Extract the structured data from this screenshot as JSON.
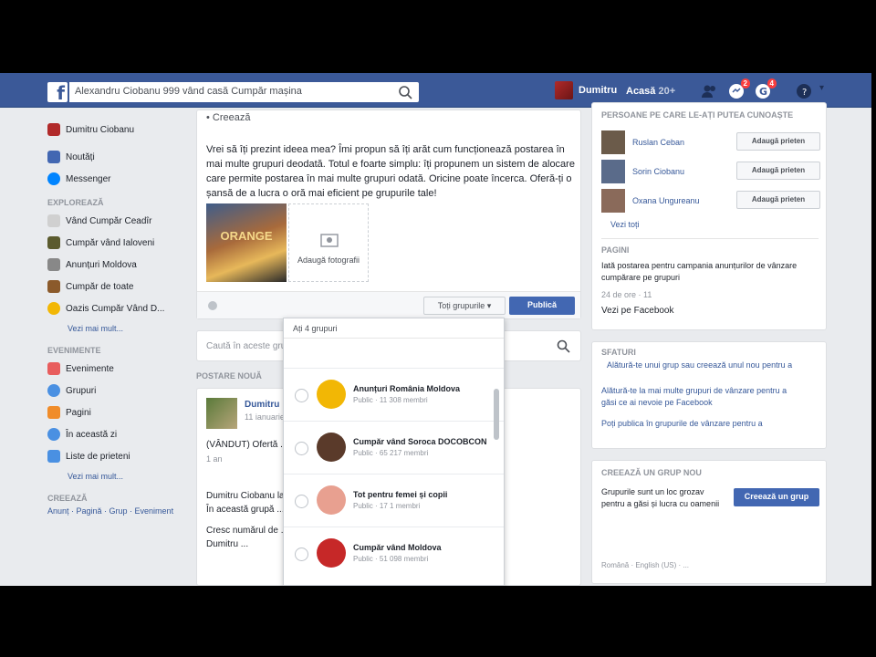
{
  "header": {
    "logo": "f",
    "search_value": "Alexandru Ciobanu 999 vând casă Cumpăr mașina",
    "user_name": "Dumitru",
    "home_label": "Acasă",
    "messages_badge": "2",
    "notifications_badge": "4"
  },
  "sidebar": {
    "profile": "Dumitru Ciobanu",
    "items": [
      {
        "label": "Noutăți",
        "color": "#4267b2"
      },
      {
        "label": "Messenger",
        "color": "#0084ff"
      }
    ],
    "explore_header": "EXPLOREAZĂ",
    "explore": [
      {
        "label": "Vând Cumpăr Ceadîr",
        "color": "#d0d0d0"
      },
      {
        "label": "Cumpăr vând Ialoveni",
        "color": "#5b5b2e"
      },
      {
        "label": "Anunțuri Moldova",
        "color": "#888888"
      },
      {
        "label": "Cumpăr de toate",
        "color": "#8b5a2b"
      },
      {
        "label": "Oazis Cumpăr Vând D...",
        "color": "#f2b705"
      }
    ],
    "explore_more": "Vezi mai mult...",
    "groups_header": "EVENIMENTE",
    "groups": [
      {
        "label": "Evenimente",
        "color": "#e85d5d"
      },
      {
        "label": "Grupuri",
        "color": "#4a90e2"
      },
      {
        "label": "Pagini",
        "color": "#f08c2a"
      },
      {
        "label": "În această zi",
        "color": "#4a90e2"
      },
      {
        "label": "Liste de prieteni",
        "color": "#4a90e2"
      }
    ],
    "groups_more": "Vezi mai mult...",
    "create_header": "CREEAZĂ",
    "create_links": "Anunț · Pagină · Grup · Eveniment"
  },
  "composer": {
    "title": "Creează",
    "text": "Vrei să îți prezint ideea mea? Îmi propun să îți arăt cum funcționează postarea în mai multe grupuri deodată. Totul e foarte simplu: îți propunem un sistem de alocare care permite postarea în mai multe grupuri odată. Oricine poate încerca. Oferă-ți o șansă de a lucra o oră mai eficient pe grupurile tale!",
    "thumb_label": "ORANGE",
    "add_photo": "Adaugă fotografii",
    "audience": "Toți grupurile",
    "publish": "Publică"
  },
  "group_search": {
    "placeholder": "Caută în aceste grupuri"
  },
  "feed": {
    "section_label": "POSTARE NOUĂ",
    "author": "Dumitru",
    "meta": "11 ianuarie",
    "lines": [
      "(VÂNDUT) Ofertă ...",
      "1 an",
      "Dumitru Ciobanu la ...",
      "În această grupă ...",
      "Cresc numărul de ...",
      "Dumitru ..."
    ]
  },
  "dropdown": {
    "header": "Ați 4 grupuri",
    "items": [
      {
        "name": "Anunțuri România Moldova",
        "sub": "Public · 11 308 membri",
        "color": "#f2b705"
      },
      {
        "name": "Cumpăr vând Soroca DOCOBCON",
        "sub": "Public · 65 217 membri",
        "color": "#5a3a2a"
      },
      {
        "name": "Tot pentru femei și copii",
        "sub": "Public · 17 1 membri",
        "color": "#e8a090"
      },
      {
        "name": "Cumpăr vând Moldova",
        "sub": "Public · 51 098 membri",
        "color": "#c62828"
      }
    ]
  },
  "right": {
    "suggest_header": "PERSOANE PE CARE LE-AȚI PUTEA CUNOAȘTE",
    "people": [
      {
        "name": "Ruslan Ceban",
        "color": "#6b5b4a"
      },
      {
        "name": "Sorin Ciobanu",
        "color": "#5a6b8a"
      },
      {
        "name": "Oxana Ungureanu",
        "color": "#8a6a5a"
      }
    ],
    "add_friend": "Adaugă prieten",
    "see_all": "Vezi toți",
    "pages_header": "PAGINI",
    "pages_text": "Iată postarea pentru campania anunțurilor de vânzare cumpărare pe grupuri",
    "pages_meta": "24 de ore · 11",
    "pages_link": "Vezi pe Facebook",
    "tips_header": "SFATURI",
    "tips_lines": [
      "Alătură-te unui grup sau creează unul nou pentru a",
      "Alătură-te la mai multe grupuri de vânzare pentru a",
      "găsi ce ai nevoie pe Facebook",
      "Poți publica în grupurile de vânzare pentru a"
    ],
    "create_header": "CREEAZĂ UN GRUP NOU",
    "create_text": "Grupurile sunt un loc grozav pentru a găsi și lucra cu oamenii",
    "create_btn": "Creează un grup",
    "create_meta": "Română · English (US) · ..."
  }
}
